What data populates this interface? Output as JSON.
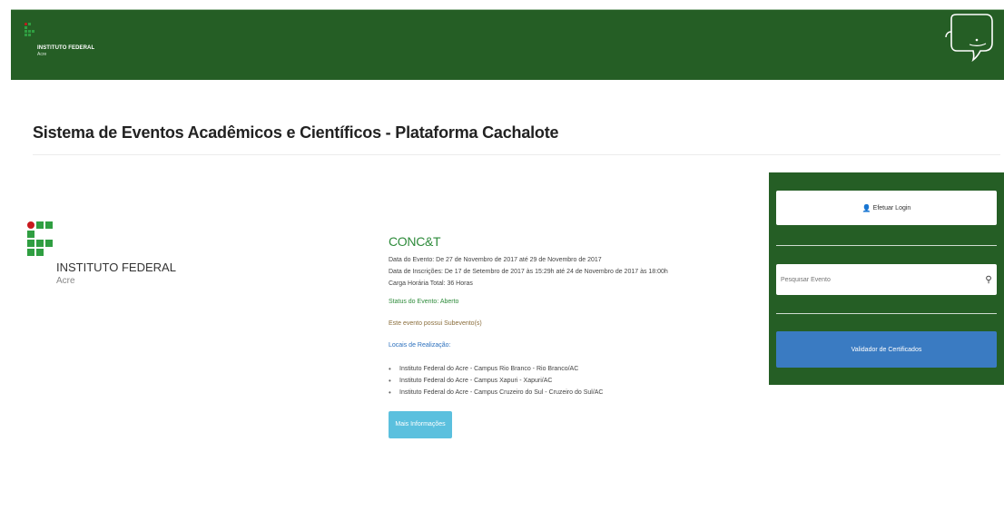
{
  "header": {
    "logo_name": "INSTITUTO FEDERAL",
    "logo_sub": "Acre",
    "mascot_icon": "whale-icon"
  },
  "page": {
    "title": "Sistema de Eventos Acadêmicos e Científicos - Plataforma Cachalote"
  },
  "main_logo": {
    "name": "INSTITUTO FEDERAL",
    "sub": "Acre"
  },
  "event": {
    "name": "CONC&T",
    "date_event": "Data do Evento: De 27 de Novembro de 2017 até 29 de Novembro de 2017",
    "date_registration": "Data de Inscrições: De 17 de Setembro de 2017 às 15:29h até 24 de Novembro de 2017 às 18:00h",
    "workload": "Carga Horária Total: 36 Horas",
    "status": "Status do Evento: Aberto",
    "subevent_note": "Este evento possui Subevento(s)",
    "locations_label": "Locais de Realização:",
    "locations": [
      "Instituto Federal do Acre - Campus Rio Branco - Rio Branco/AC",
      "Instituto Federal do Acre - Campus Xapuri - Xapuri/AC",
      "Instituto Federal do Acre - Campus Cruzeiro do Sul - Cruzeiro do Sul/AC"
    ],
    "more_info_label": "Mais Informações ⊕"
  },
  "sidebar": {
    "login_label": "Efetuar Login",
    "search_placeholder": "Pesquisar Evento",
    "validator_label": "Validador de Certificados"
  },
  "colors": {
    "brand_green": "#255e25",
    "logo_green": "#2f9e41",
    "logo_red": "#c8191e",
    "info_button": "#5bc0de",
    "validator_button": "#3a7bc2"
  }
}
